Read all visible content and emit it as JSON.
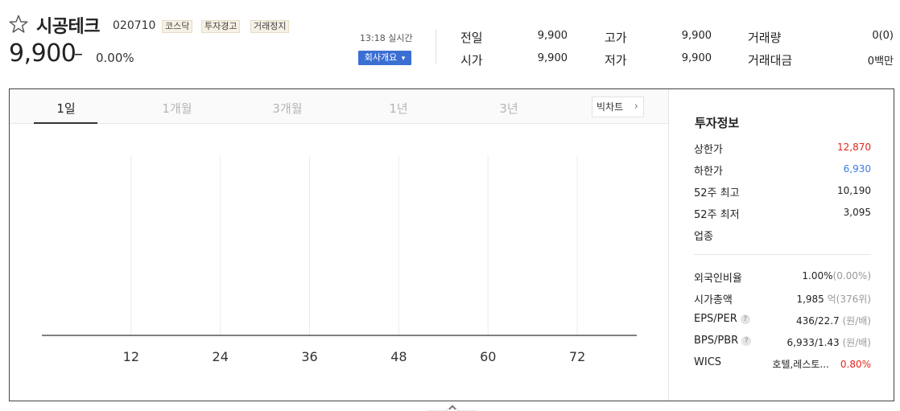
{
  "stock": {
    "name": "시공테크",
    "code": "020710",
    "badges": [
      "코스닥",
      "투자경고",
      "거래정지"
    ],
    "price": "9,900",
    "change_sign": "–",
    "change_rate": "0.00%",
    "realtime": "13:18 실시간",
    "company_button": "회사개요",
    "company_button_arrow": "▾",
    "favorite_icon": "star-outline-icon"
  },
  "quotes": [
    {
      "label": "전일",
      "value": "9,900"
    },
    {
      "label": "시가",
      "value": "9,900"
    },
    {
      "label": "고가",
      "value": "9,900"
    },
    {
      "label": "저가",
      "value": "9,900"
    },
    {
      "label": "거래량",
      "value": "0(0)"
    },
    {
      "label": "거래대금",
      "value": "0백만"
    }
  ],
  "tabs": [
    "1일",
    "1개월",
    "3개월",
    "1년",
    "3년"
  ],
  "active_tab": "1일",
  "big_chart": {
    "label": "빅차트",
    "arrow": "›"
  },
  "chart_data": {
    "type": "line",
    "title": "",
    "xlabel": "",
    "ylabel": "",
    "x_ticks": [
      "12",
      "24",
      "36",
      "48",
      "60",
      "72"
    ],
    "xlim": [
      0,
      80
    ],
    "series": [],
    "grid": "vertical"
  },
  "invest": {
    "title": "투자정보",
    "upper_limit": {
      "label": "상한가",
      "value": "12,870",
      "color": "#e0271c"
    },
    "lower_limit": {
      "label": "하한가",
      "value": "6,930",
      "color": "#3c7be0"
    },
    "high52": {
      "label": "52주 최고",
      "value": "10,190"
    },
    "low52": {
      "label": "52주 최저",
      "value": "3,095"
    },
    "sector": {
      "label": "업종",
      "value": ""
    },
    "foreign_ratio": {
      "label": "외국인비율",
      "value": "1.00%",
      "sub": "(0.00%)"
    },
    "market_cap": {
      "label": "시가총액",
      "value": "1,985",
      "sub": "억(376위)"
    },
    "eps_per": {
      "label": "EPS/PER",
      "value": "436/22.7",
      "sub": "(원/배)",
      "help": "?"
    },
    "bps_pbr": {
      "label": "BPS/PBR",
      "value": "6,933/1.43",
      "sub": "(원/배)",
      "help": "?"
    },
    "wics": {
      "label": "WICS",
      "value": "호텔,레스토...",
      "rate": "0.80%",
      "rate_color": "#e0271c"
    }
  },
  "fold": {
    "icon": "chevron-up-icon",
    "glyph": "⌃"
  }
}
